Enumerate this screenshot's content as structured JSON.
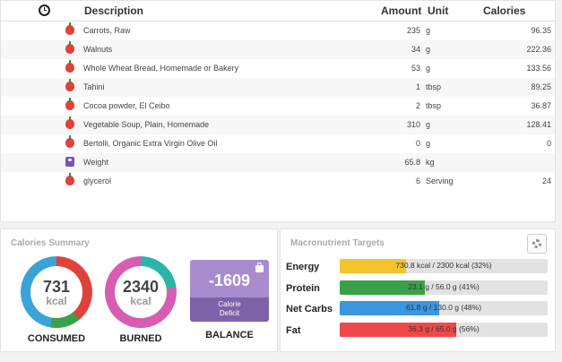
{
  "diary": {
    "headers": {
      "description": "Description",
      "amount": "Amount",
      "unit": "Unit",
      "calories": "Calories"
    },
    "rows": [
      {
        "icon": "apple-icon",
        "description": "Carrots, Raw",
        "amount": "235",
        "unit": "g",
        "calories": "96.35"
      },
      {
        "icon": "apple-icon",
        "description": "Walnuts",
        "amount": "34",
        "unit": "g",
        "calories": "222.36"
      },
      {
        "icon": "apple-icon",
        "description": "Whole Wheat Bread, Homemade or Bakery",
        "amount": "53",
        "unit": "g",
        "calories": "133.56"
      },
      {
        "icon": "apple-icon",
        "description": "Tahini",
        "amount": "1",
        "unit": "tbsp",
        "calories": "89.25"
      },
      {
        "icon": "apple-icon",
        "description": "Cocoa powder, El Ceibo",
        "amount": "2",
        "unit": "tbsp",
        "calories": "36.87"
      },
      {
        "icon": "apple-icon",
        "description": "Vegetable Soup, Plain, Homemade",
        "amount": "310",
        "unit": "g",
        "calories": "128.41"
      },
      {
        "icon": "apple-icon",
        "description": "Bertolli, Organic Extra Virgin Olive Oil",
        "amount": "0",
        "unit": "g",
        "calories": "0"
      },
      {
        "icon": "weight-icon",
        "description": "Weight",
        "amount": "65.8",
        "unit": "kg",
        "calories": ""
      },
      {
        "icon": "apple-icon",
        "description": "glycerol",
        "amount": "6",
        "unit": "Serving",
        "calories": "24"
      }
    ]
  },
  "calories_summary": {
    "title": "Calories Summary",
    "consumed": {
      "value": "731",
      "unit": "kcal",
      "label": "CONSUMED"
    },
    "burned": {
      "value": "2340",
      "unit": "kcal",
      "label": "BURNED"
    },
    "balance": {
      "value": "-1609",
      "sublabel": "Calorie\nDeficit",
      "label": "BALANCE"
    }
  },
  "macronutrients": {
    "title": "Macronutrient Targets",
    "items": [
      {
        "name": "Energy",
        "text": "730.8 kcal / 2300 kcal (32%)",
        "fraction": 0.32,
        "color": "#f5c32c"
      },
      {
        "name": "Protein",
        "text": "23.1 g / 56.0 g (41%)",
        "fraction": 0.41,
        "color": "#3aa148"
      },
      {
        "name": "Net Carbs",
        "text": "61.8 g / 130.0 g (48%)",
        "fraction": 0.48,
        "color": "#3b95e0"
      },
      {
        "name": "Fat",
        "text": "36.3 g / 65.0 g (56%)",
        "fraction": 0.56,
        "color": "#f04848"
      }
    ]
  }
}
